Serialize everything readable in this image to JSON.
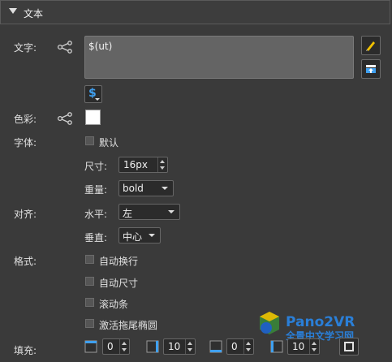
{
  "section": {
    "title": "文本"
  },
  "text_field": {
    "label": "文字:",
    "value": "$(ut)"
  },
  "variable_button": {
    "symbol": "$"
  },
  "color": {
    "label": "色彩:",
    "value": "#ffffff"
  },
  "font": {
    "label": "字体:",
    "default_label": "默认",
    "size_label": "尺寸:",
    "size_value": "16px",
    "weight_label": "重量:",
    "weight_value": "bold"
  },
  "align": {
    "label": "对齐:",
    "horizontal_label": "水平:",
    "horizontal_value": "左",
    "vertical_label": "垂直:",
    "vertical_value": "中心"
  },
  "format": {
    "label": "格式:",
    "options": [
      "自动换行",
      "自动尺寸",
      "滚动条",
      "激活拖尾椭圆"
    ]
  },
  "padding": {
    "label": "填充:",
    "top": "0",
    "right": "10",
    "bottom": "0",
    "left": "10"
  },
  "watermark": {
    "brand": "Pano2VR",
    "subtitle": "全景中文学习网"
  },
  "colors": {
    "background": "#3a3a3a",
    "accent": "#3fa0f0",
    "pencil": "#f2c200"
  }
}
